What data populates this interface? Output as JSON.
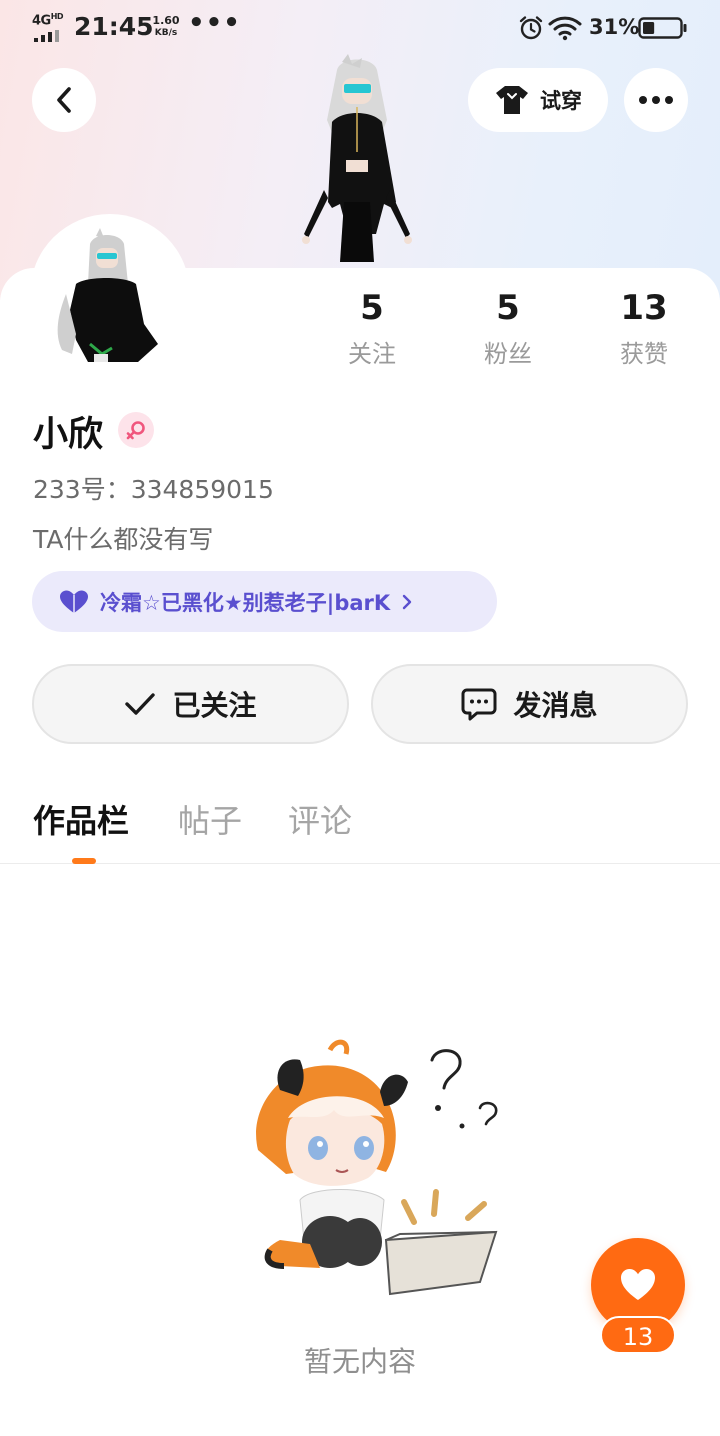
{
  "status_bar": {
    "network": "4G",
    "network_hd": "HD",
    "time": "21:45",
    "speed_value": "1.60",
    "speed_unit": "KB/s",
    "more_dots": "•••",
    "battery_percent": "31%",
    "battery_level": 0.31,
    "icons": [
      "signal-icon",
      "alarm-icon",
      "wifi-icon",
      "battery-icon"
    ]
  },
  "header": {
    "back_icon": "chevron-left-icon",
    "try_on_label": "试穿",
    "try_on_icon": "tshirt-icon",
    "more_icon": "more-dots-icon"
  },
  "profile": {
    "stats": [
      {
        "value": "5",
        "label": "关注"
      },
      {
        "value": "5",
        "label": "粉丝"
      },
      {
        "value": "13",
        "label": "获赞"
      }
    ],
    "name": "小欣",
    "gender_icon": "female-icon",
    "user_id": "233号：334859015",
    "bio": "TA什么都没有写",
    "honor_tag": "冷霜☆已黑化★别惹老子|barK"
  },
  "actions": {
    "follow_label": "已关注",
    "message_label": "发消息"
  },
  "tabs": [
    {
      "label": "作品栏",
      "active": true
    },
    {
      "label": "帖子",
      "active": false
    },
    {
      "label": "评论",
      "active": false
    }
  ],
  "empty_state": {
    "text": "暂无内容"
  },
  "like_fab": {
    "count": "13"
  },
  "colors": {
    "accent_orange": "#ff6a12",
    "honor_purple": "#5a4fcf",
    "honor_bg": "#ebeafb",
    "gender_pink": "#f0567d"
  }
}
